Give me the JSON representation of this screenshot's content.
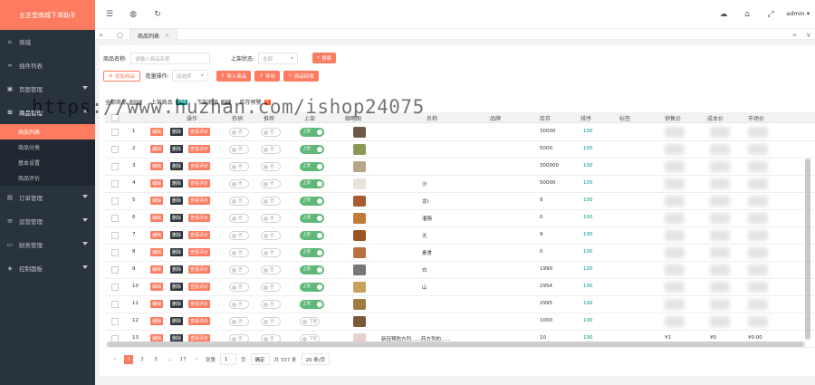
{
  "sidebar": {
    "logo": "五芝堂商城下单助手",
    "items": [
      {
        "label": "商城",
        "icon": "home-icon",
        "expandable": false
      },
      {
        "label": "插件列表",
        "icon": "link-icon",
        "expandable": false
      },
      {
        "label": "页面管理",
        "icon": "layers-icon",
        "expandable": true
      },
      {
        "label": "商品管理",
        "icon": "cart-icon",
        "expandable": true,
        "open": true,
        "children": [
          "商品列表",
          "商品分类",
          "基本设置",
          "商品评价"
        ]
      },
      {
        "label": "订单管理",
        "icon": "order-icon",
        "expandable": true
      },
      {
        "label": "运营管理",
        "icon": "chat-icon",
        "expandable": true
      },
      {
        "label": "财务管理",
        "icon": "wallet-icon",
        "expandable": true
      },
      {
        "label": "控制面板",
        "icon": "dashboard-icon",
        "expandable": true
      }
    ]
  },
  "header": {
    "user": "admin ▾"
  },
  "tabs": {
    "active": "商品列表",
    "close": "×"
  },
  "filters": {
    "name_label": "商品名称:",
    "name_placeholder": "请输入商品名称",
    "status_label": "上架状态:",
    "status_value": "全部",
    "search_btn": "搜索",
    "add_btn": "添加商品",
    "batch_label": "批量操作:",
    "batch_value": "请选择",
    "import_btn": "导入商品",
    "export_btn": "导出",
    "recycle_btn": "商品回收"
  },
  "status_tabs": [
    {
      "label": "全部商品",
      "count": "337",
      "color": "#999"
    },
    {
      "label": "上架商品",
      "count": "294",
      "color": "#009688"
    },
    {
      "label": "下架商品",
      "count": "43",
      "color": "#888"
    },
    {
      "label": "库存预警",
      "count": "1",
      "color": "#ff5722"
    }
  ],
  "columns": [
    "操作",
    "热销",
    "推荐",
    "上架",
    "缩略图",
    "名称",
    "品牌",
    "库存",
    "排序",
    "标签",
    "销售价",
    "成本价",
    "市场价"
  ],
  "row_actions": {
    "edit": "编辑",
    "delete": "删除",
    "review": "查看评价",
    "no": "否",
    "off": "下架",
    "on": "上架"
  },
  "rows": [
    {
      "id": "1",
      "stock": "30000",
      "sort": "100",
      "on": true,
      "name": "",
      "thumb": "#6b5a48"
    },
    {
      "id": "2",
      "stock": "5000",
      "sort": "100",
      "on": true,
      "name": "",
      "thumb": "#8a9a55"
    },
    {
      "id": "3",
      "stock": "300000",
      "sort": "100",
      "on": true,
      "name": "",
      "thumb": "#b8a68a"
    },
    {
      "id": "4",
      "stock": "50000",
      "sort": "100",
      "on": true,
      "name": "沙",
      "thumb": "#e8e4dc"
    },
    {
      "id": "5",
      "stock": "9",
      "sort": "100",
      "on": true,
      "name": "龙I",
      "thumb": "#a85a30"
    },
    {
      "id": "6",
      "stock": "0",
      "sort": "100",
      "on": true,
      "name": "灌肠",
      "thumb": "#c07a3a"
    },
    {
      "id": "7",
      "stock": "9",
      "sort": "100",
      "on": true,
      "name": "无",
      "thumb": "#9a5522"
    },
    {
      "id": "8",
      "stock": "0",
      "sort": "100",
      "on": true,
      "name": "素食",
      "thumb": "#b87040"
    },
    {
      "id": "9",
      "stock": "1990",
      "sort": "100",
      "on": true,
      "name": "白",
      "thumb": "#777"
    },
    {
      "id": "10",
      "stock": "2954",
      "sort": "100",
      "on": true,
      "name": "山",
      "thumb": "#c8a060"
    },
    {
      "id": "11",
      "stock": "2995",
      "sort": "100",
      "on": true,
      "name": "",
      "thumb": "#a07a40"
    },
    {
      "id": "12",
      "stock": "1000",
      "sort": "100",
      "on": false,
      "name": "",
      "thumb": "#7a5a38"
    },
    {
      "id": "13",
      "stock": "10",
      "sort": "100",
      "on": false,
      "name": "新冠预防方剂……药方剂的……",
      "thumb": "#e8d0d0",
      "sale": "¥1",
      "cost": "¥0",
      "market": "¥0.00"
    }
  ],
  "pager": {
    "pages": [
      "1",
      "2",
      "3",
      "...",
      "17"
    ],
    "goto_label": "到第",
    "goto_value": "1",
    "page_unit": "页",
    "confirm": "确定",
    "total": "共 337 条",
    "per_page": "20 条/页"
  },
  "watermark": "https://www.huzhan.com/ishop24075"
}
